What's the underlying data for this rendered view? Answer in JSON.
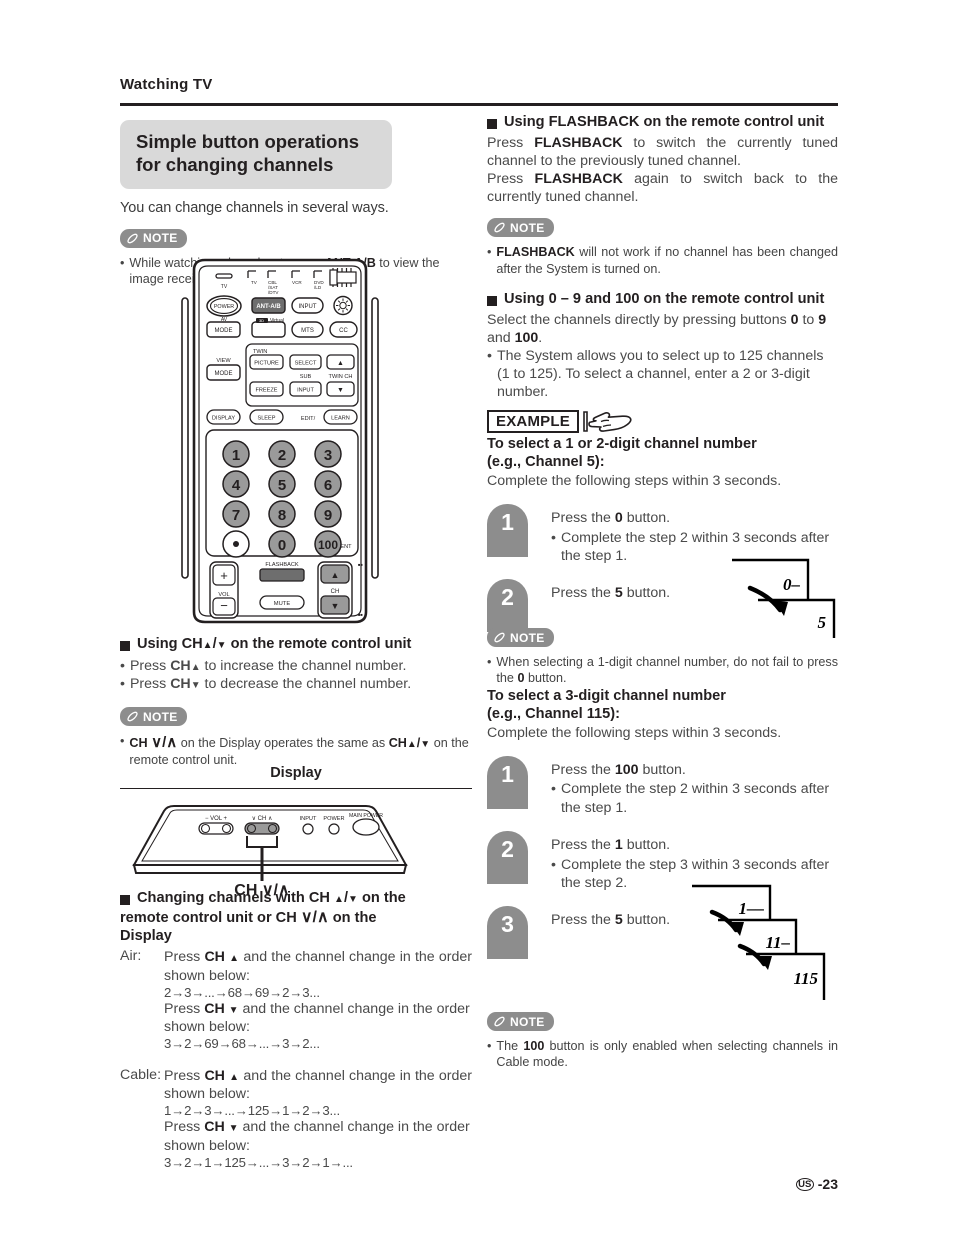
{
  "header": {
    "title": "Watching TV"
  },
  "footer": {
    "region": "US",
    "page": "-23"
  },
  "left": {
    "section_title": "Simple button operations for changing channels",
    "lead": "You can change channels in several ways.",
    "note1": {
      "label": "NOTE",
      "text_a": "While watching a broadcast, press ",
      "text_b": "ANT-A/B",
      "text_c": " to view the image received from the other tuner."
    },
    "remote": {
      "top_labels": [
        "TV",
        "CBL /SAT /DTV",
        "VCR",
        "DVD /LD"
      ],
      "tv_label": "TV",
      "av_label": "AV",
      "virtual_label": "Virtual",
      "view_label": "VIEW",
      "twin_label": "TWIN",
      "sub_label": "SUB",
      "twin_ch_label": "TWIN CH",
      "edit_label": "EDIT/",
      "vol_label": "VOL",
      "ch_label": "CH",
      "ent_label": "ENT",
      "buttons": {
        "power": "POWER",
        "ant_ab": "ANT-A/B",
        "input": "INPUT",
        "light": "light-bulb",
        "mode1": "MODE",
        "blank": "",
        "mts": "MTS",
        "cc": "CC",
        "picture": "PICTURE",
        "select": "SELECT",
        "up": "▲",
        "mode2": "MODE",
        "freeze": "FREEZE",
        "input2": "INPUT",
        "down": "▼",
        "display": "DISPLAY",
        "sleep": "SLEEP",
        "learn": "LEARN",
        "flashback": "FLASHBACK",
        "mute": "MUTE",
        "vol_plus": "+",
        "vol_minus": "−"
      },
      "keypad": [
        "1",
        "2",
        "3",
        "4",
        "5",
        "6",
        "7",
        "8",
        "9",
        "•",
        "0",
        "100"
      ]
    },
    "s1": {
      "heading_a": "Using CH",
      "heading_b": "/",
      "heading_c": " on the remote control unit",
      "b1_a": "Press ",
      "b1_b": "CH",
      "b1_c": " to increase the channel number.",
      "b2_a": "Press ",
      "b2_b": "CH",
      "b2_c": " to decrease the channel number."
    },
    "note2": {
      "label": "NOTE",
      "a": "CH ",
      "b": "∨/∧",
      "c": " on the Display operates the same as ",
      "d": "CH",
      "e": "/",
      "f": " on the remote control unit."
    },
    "display_fig": {
      "title": "Display",
      "vol_label": "− VOL +",
      "ch_label": "∨ CH ∧",
      "input_label": "INPUT",
      "power_label": "POWER",
      "main_power_label": "MAIN POWER",
      "caption": "CH ∨/∧"
    },
    "s2": {
      "heading_1": "Changing channels with CH ",
      "heading_2": "/",
      "heading_3": " on the",
      "heading_4": "remote control unit or CH ",
      "heading_5": "∨/∧",
      "heading_6": " on the",
      "heading_7": "Display",
      "air_key": "Air:",
      "air_line1_a": "Press ",
      "air_line1_b": "CH",
      "air_line1_c": " and the channel change in the order shown below:",
      "air_seq_up": "2→3→...→68→69→2→3...",
      "air_line2_a": "Press ",
      "air_line2_b": "CH",
      "air_line2_c": " and the channel change in the order shown below:",
      "air_seq_down": "3→2→69→68→...→3→2...",
      "cable_key": "Cable:",
      "cable_line1_a": "Press ",
      "cable_line1_b": "CH",
      "cable_line1_c": " and the channel change in the order shown below:",
      "cable_seq_up": "1→2→3→...→125→1→2→3...",
      "cable_line2_a": "Press ",
      "cable_line2_b": "CH",
      "cable_line2_c": " and the channel change in the order shown below:",
      "cable_seq_down": "3→2→1→125→...→3→2→1→..."
    }
  },
  "right": {
    "s3": {
      "heading": "Using FLASHBACK on the remote control unit",
      "p1_a": "Press ",
      "p1_b": "FLASHBACK",
      "p1_c": " to switch the currently tuned channel to the previously tuned channel.",
      "p2_a": "Press ",
      "p2_b": "FLASHBACK",
      "p2_c": " again to switch back to the currently tuned channel."
    },
    "note3": {
      "label": "NOTE",
      "a": "FLASHBACK",
      "b": " will not work if no channel has been changed after the System is turned on."
    },
    "s4": {
      "heading": "Using 0 – 9 and 100 on the remote control unit",
      "p1_a": "Select the channels directly by pressing buttons ",
      "p1_b": "0",
      "p1_c": " to ",
      "p1_d": "9",
      "p1_e": " and ",
      "p1_f": "100",
      "p1_g": ".",
      "bul": "The System allows you to select up to 125 channels (1 to 125). To select a channel, enter a 2 or 3-digit number."
    },
    "example_label": "EXAMPLE",
    "ex1": {
      "title_line1": "To select a 1 or 2-digit channel number",
      "title_line2": "(e.g., Channel 5):",
      "subtitle": "Complete the following steps within 3 seconds.",
      "steps": [
        {
          "n": "1",
          "main_a": "Press the ",
          "main_b": "0",
          "main_c": " button.",
          "sub": "Complete the step 2 within 3 seconds after the step 1."
        },
        {
          "n": "2",
          "main_a": "Press the ",
          "main_b": "5",
          "main_c": " button.",
          "sub": ""
        }
      ],
      "diagram_values": [
        "0–",
        "5"
      ]
    },
    "note4": {
      "label": "NOTE",
      "a": "When selecting a 1-digit channel number, do not fail to press the ",
      "b": "0",
      "c": " button."
    },
    "ex2": {
      "title_line1": "To select a 3-digit channel number",
      "title_line2": "(e.g., Channel 115):",
      "subtitle": "Complete the following steps within 3 seconds.",
      "steps": [
        {
          "n": "1",
          "main_a": "Press the ",
          "main_b": "100",
          "main_c": " button.",
          "sub": "Complete the step 2 within 3 seconds after the step 1."
        },
        {
          "n": "2",
          "main_a": "Press the ",
          "main_b": "1",
          "main_c": " button.",
          "sub": "Complete the step 3 within 3 seconds after the step 2."
        },
        {
          "n": "3",
          "main_a": "Press the ",
          "main_b": "5",
          "main_c": " button.",
          "sub": ""
        }
      ],
      "diagram_values": [
        "1––",
        "11–",
        "115"
      ]
    },
    "note5": {
      "label": "NOTE",
      "a": "The ",
      "b": "100",
      "c": " button is only enabled when selecting channels in Cable mode."
    }
  },
  "colors": {
    "ink": "#231f20",
    "body": "#4a4a4a",
    "grey_badge": "#8d8d8d",
    "pill_grey": "#d9d9d9",
    "key_grey": "#9a9a9a"
  }
}
